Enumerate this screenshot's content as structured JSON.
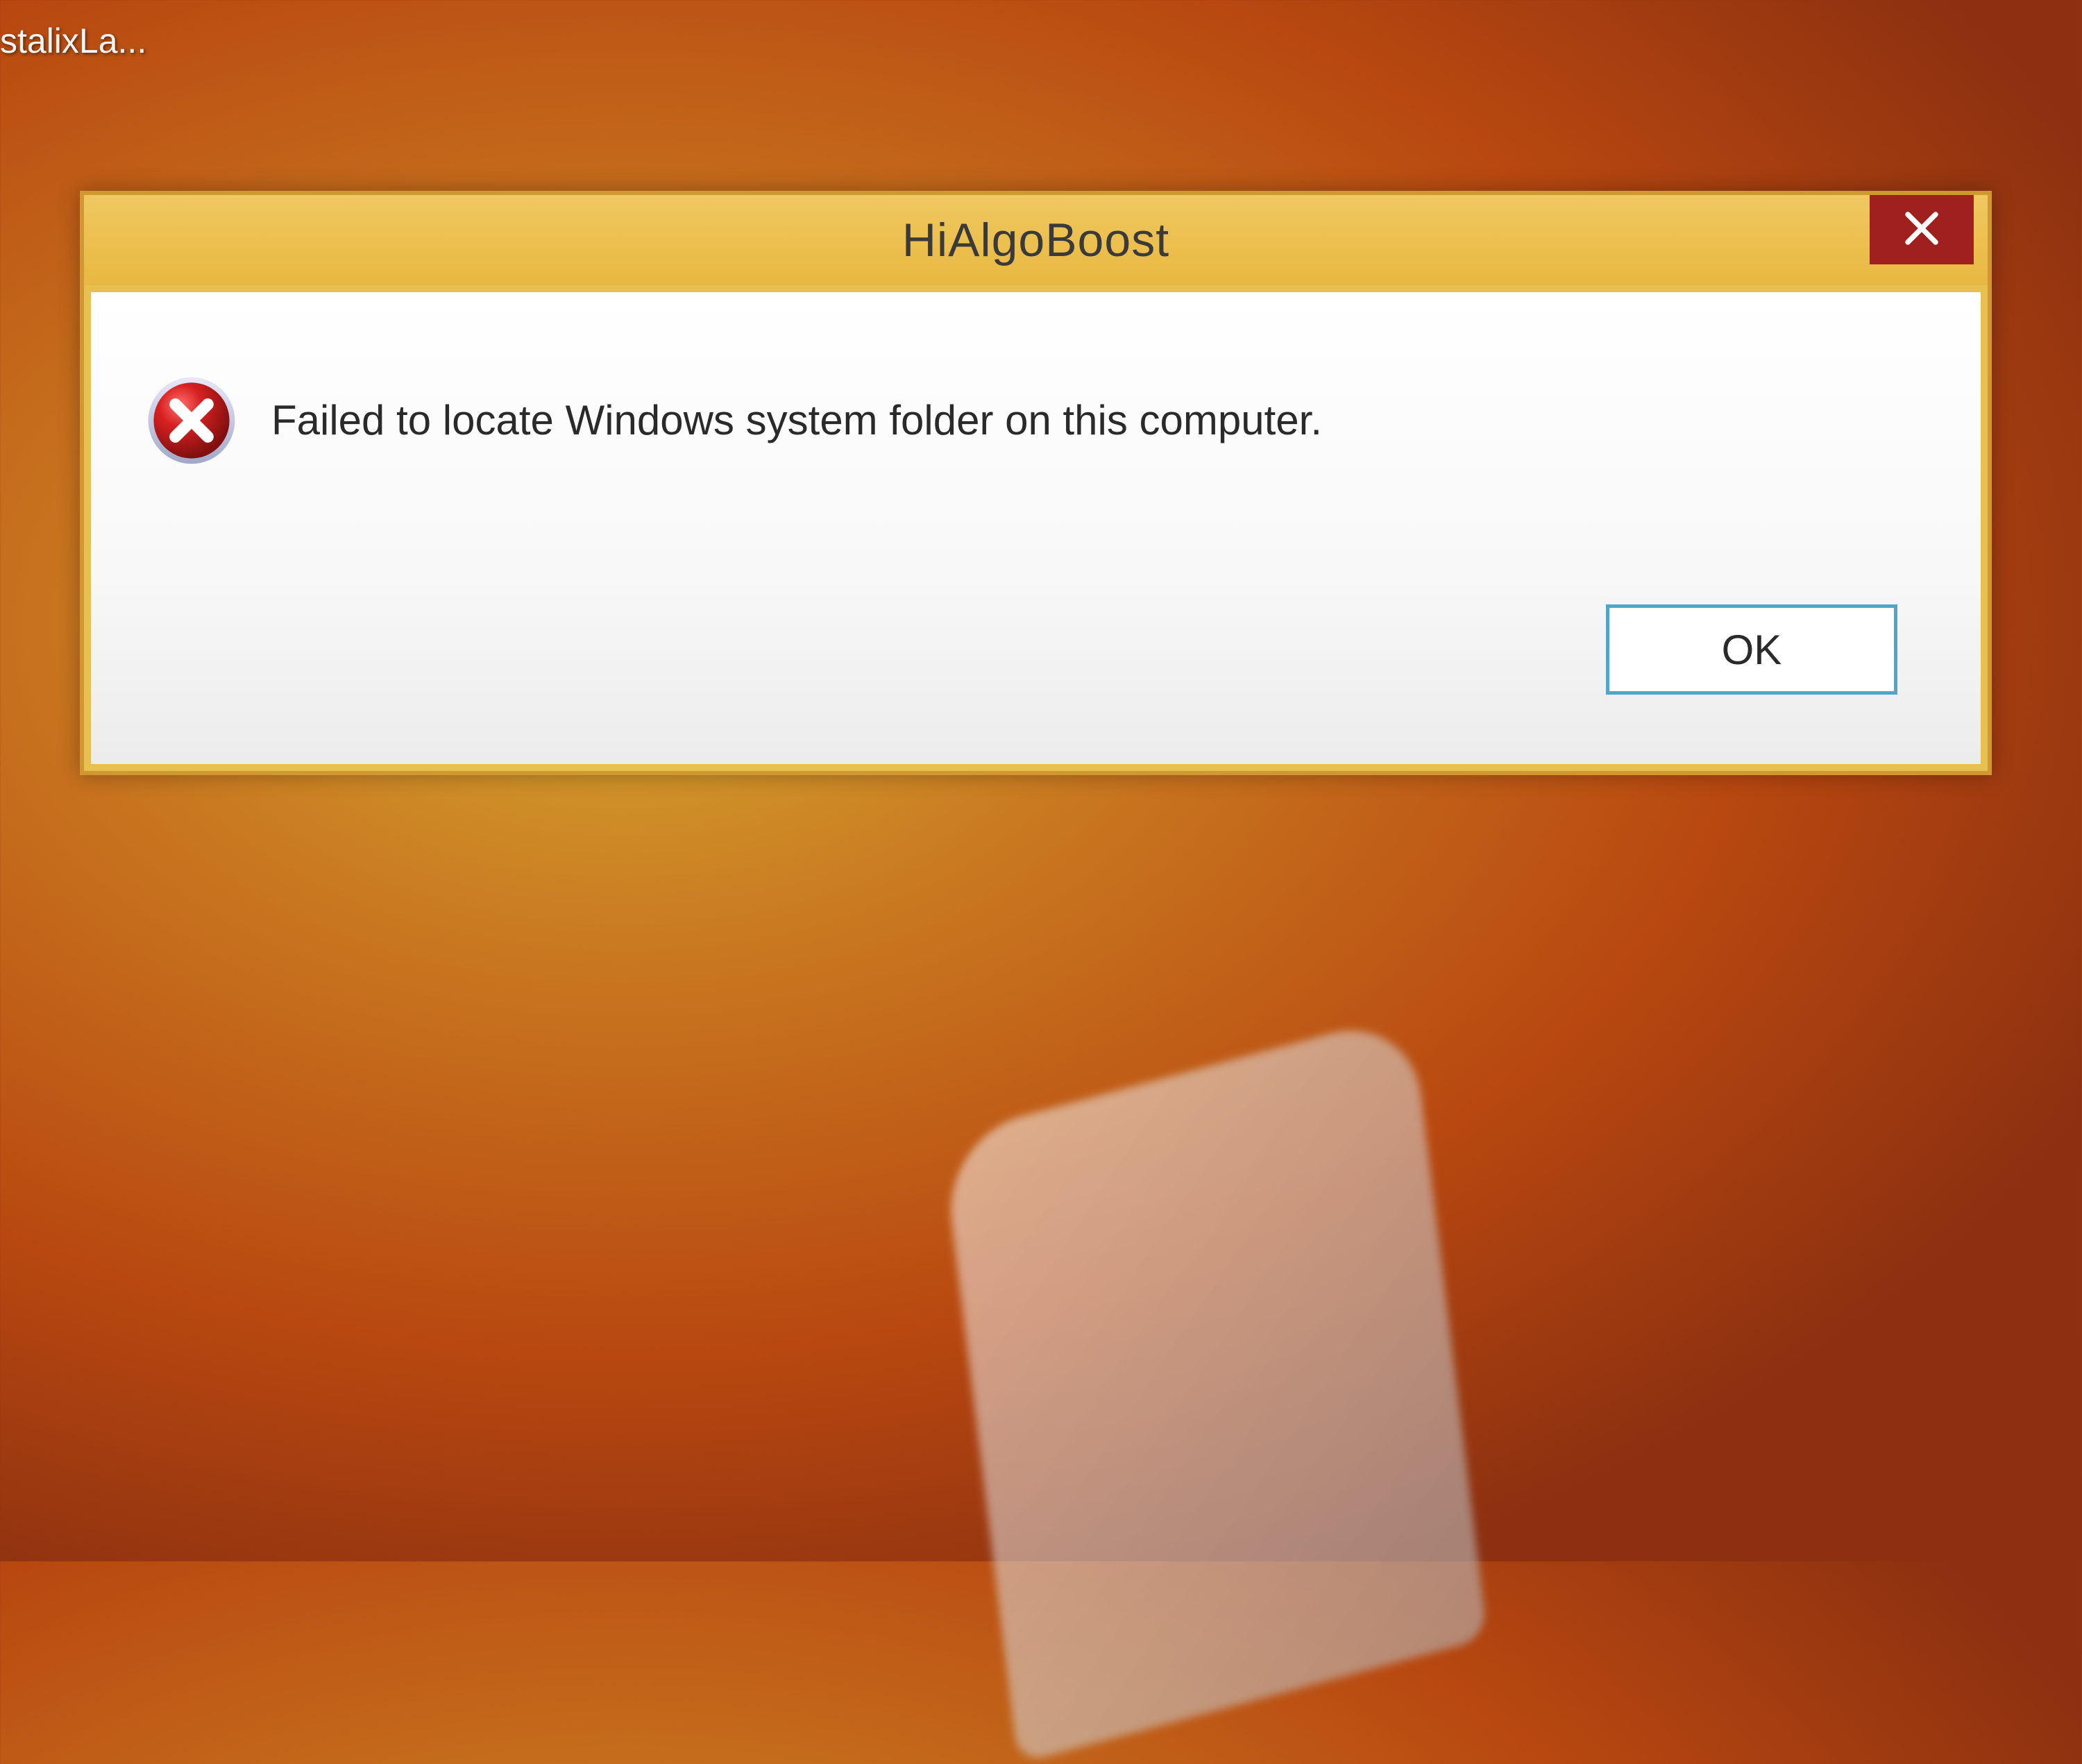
{
  "desktop": {
    "icon_label": "stalixLa..."
  },
  "dialog": {
    "title": "HiAlgoBoost",
    "message": "Failed to locate Windows system folder on this computer.",
    "ok_label": "OK"
  }
}
